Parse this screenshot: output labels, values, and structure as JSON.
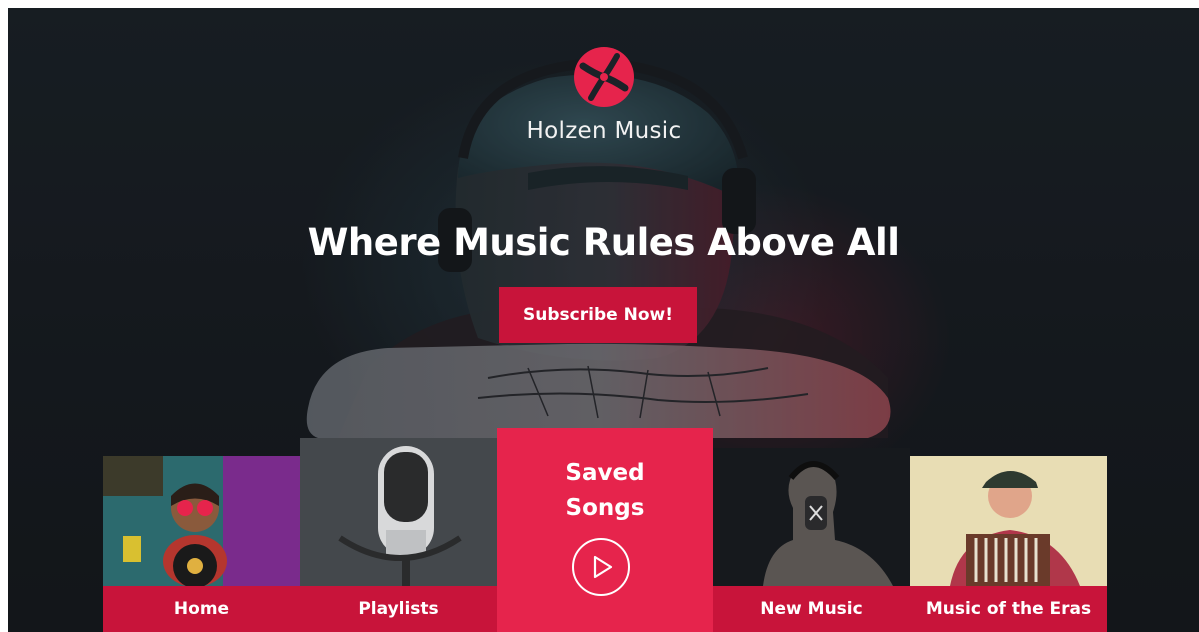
{
  "brand": {
    "name": "Holzen Music",
    "logo_icon": "holzen-logo-icon",
    "accent_color": "#e6244c",
    "accent_dark": "#c8143a"
  },
  "hero": {
    "headline": "Where Music Rules Above All",
    "cta_label": "Subscribe Now!"
  },
  "nav_cards": {
    "home": {
      "label": "Home",
      "image": "person-with-vinyl-record"
    },
    "playlists": {
      "label": "Playlists",
      "image": "studio-microphone"
    },
    "saved": {
      "title_line1": "Saved",
      "title_line2": "Songs",
      "icon": "play-circle-icon"
    },
    "new_music": {
      "label": "New Music",
      "image": "man-with-headphones"
    },
    "eras": {
      "label": "Music of the Eras",
      "image": "man-with-accordion"
    }
  }
}
